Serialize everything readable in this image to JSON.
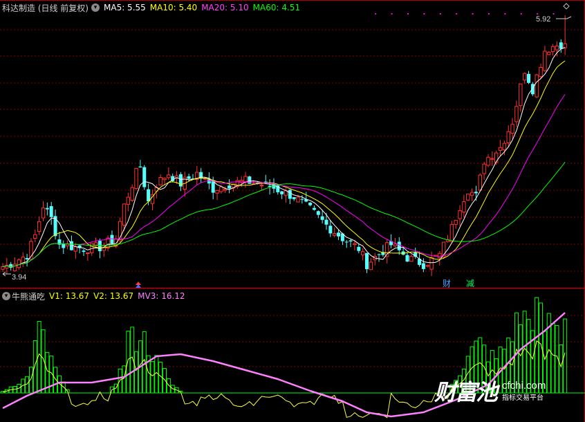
{
  "main_header": {
    "title": "科达制造 (日线 前复权)",
    "ma5": "MA5: 5.55",
    "ma10": "MA10: 5.40",
    "ma20": "MA20: 5.10",
    "ma60": "MA60: 4.51"
  },
  "price_labels": {
    "high": "5.92",
    "low": "3.94"
  },
  "markers": {
    "cai": "财",
    "jian": "减"
  },
  "sub_header": {
    "title": "牛熊通吃",
    "v1": "V1: 13.67",
    "v2": "V2: 13.67",
    "mv3": "MV3: 16.12"
  },
  "watermark": {
    "cn": "财富池",
    "url": "cfchi.com",
    "sub": "指标交易平台"
  },
  "colors": {
    "up": "#ff3232",
    "down": "#54ffff",
    "ma5": "#ffffff",
    "ma10": "#ffff00",
    "ma20": "#ff00ff",
    "ma60": "#00ff00",
    "grid": "#8b0000",
    "vol": "#00ff00",
    "mv3": "#ff80ff"
  },
  "chart_data": [
    {
      "type": "candlestick",
      "title": "科达制造 (日线 前复权)",
      "ylim": [
        3.94,
        5.92
      ],
      "annotations": [
        "5.92",
        "3.94"
      ],
      "series": [
        {
          "name": "MA5",
          "last": 5.55
        },
        {
          "name": "MA10",
          "last": 5.4
        },
        {
          "name": "MA20",
          "last": 5.1
        },
        {
          "name": "MA60",
          "last": 4.51
        }
      ]
    },
    {
      "type": "bar",
      "title": "牛熊通吃",
      "series": [
        {
          "name": "V1",
          "last": 13.67
        },
        {
          "name": "V2",
          "last": 13.67
        },
        {
          "name": "MV3",
          "last": 16.12
        }
      ]
    }
  ]
}
